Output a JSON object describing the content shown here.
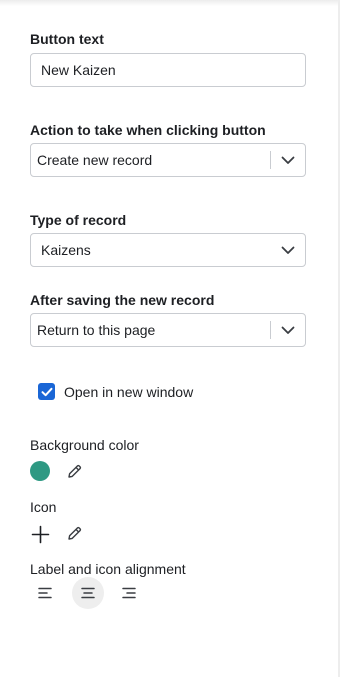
{
  "button_text": {
    "label": "Button text",
    "value": "New Kaizen"
  },
  "action": {
    "label": "Action to take when clicking button",
    "selected": "Create new record"
  },
  "record_type": {
    "label": "Type of record",
    "selected": "Kaizens"
  },
  "after_save": {
    "label": "After saving the new record",
    "selected": "Return to this page"
  },
  "new_window": {
    "label": "Open in new window",
    "checked": true
  },
  "background_color": {
    "label": "Background color",
    "value": "#2e9983",
    "edit_icon": "pencil-icon"
  },
  "icon": {
    "label": "Icon",
    "current_icon": "plus-icon",
    "edit_icon": "pencil-icon"
  },
  "alignment": {
    "label": "Label and icon alignment",
    "options": [
      "align-left-icon",
      "align-center-icon",
      "align-right-icon"
    ],
    "selected": "align-center-icon"
  },
  "colors": {
    "accent": "#1a66d6",
    "border": "#c9ccd1"
  }
}
